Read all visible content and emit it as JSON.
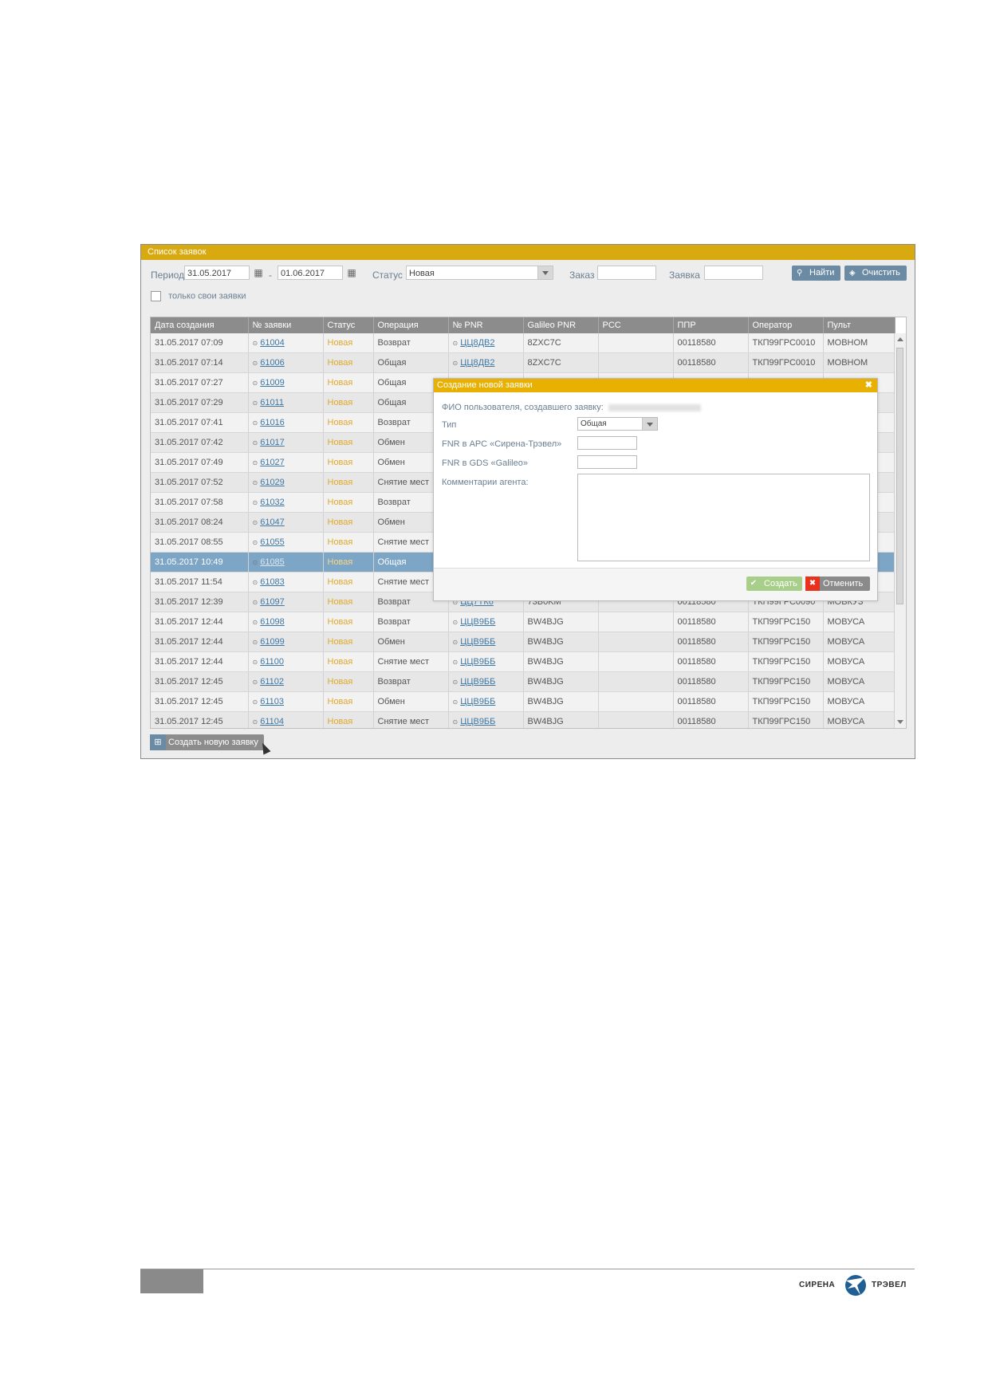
{
  "window": {
    "title": "Список заявок"
  },
  "filters": {
    "period_label": "Период",
    "date_from": "31.05.2017",
    "date_to": "01.06.2017",
    "dash": "-",
    "status_label": "Статус",
    "status_value": "Новая",
    "order_label": "Заказ",
    "order_value": "",
    "request_label": "Заявка",
    "request_value": "",
    "find_label": "Найти",
    "clear_label": "Очистить",
    "only_mine_label": "только свои заявки"
  },
  "table": {
    "columns": [
      "Дата создания",
      "№ заявки",
      "Статус",
      "Операция",
      "№ PNR",
      "Galileo PNR",
      "PCC",
      "ППР",
      "Оператор",
      "Пульт"
    ],
    "rows": [
      {
        "date": "31.05.2017 07:09",
        "num": "61004",
        "status": "Новая",
        "op": "Возврат",
        "pnr": "ЦЦ8ДВ2",
        "gpnr": "8ZXC7C",
        "pcc": "",
        "ppr": "00118580",
        "operator": "ТКП99ГРС0010",
        "pult": "МОВНОМ"
      },
      {
        "date": "31.05.2017 07:14",
        "num": "61006",
        "status": "Новая",
        "op": "Общая",
        "pnr": "ЦЦ8ДВ2",
        "gpnr": "8ZXC7C",
        "pcc": "",
        "ppr": "00118580",
        "operator": "ТКП99ГРС0010",
        "pult": "МОВНОМ"
      },
      {
        "date": "31.05.2017 07:27",
        "num": "61009",
        "status": "Новая",
        "op": "Общая",
        "pnr": "",
        "gpnr": "",
        "pcc": "",
        "ppr": "",
        "operator": "",
        "pult": ""
      },
      {
        "date": "31.05.2017 07:29",
        "num": "61011",
        "status": "Новая",
        "op": "Общая",
        "pnr": "",
        "gpnr": "",
        "pcc": "",
        "ppr": "",
        "operator": "",
        "pult": ""
      },
      {
        "date": "31.05.2017 07:41",
        "num": "61016",
        "status": "Новая",
        "op": "Возврат",
        "pnr": "",
        "gpnr": "",
        "pcc": "",
        "ppr": "",
        "operator": "",
        "pult": ""
      },
      {
        "date": "31.05.2017 07:42",
        "num": "61017",
        "status": "Новая",
        "op": "Обмен",
        "pnr": "",
        "gpnr": "",
        "pcc": "",
        "ppr": "",
        "operator": "",
        "pult": ""
      },
      {
        "date": "31.05.2017 07:49",
        "num": "61027",
        "status": "Новая",
        "op": "Обмен",
        "pnr": "",
        "gpnr": "",
        "pcc": "",
        "ppr": "",
        "operator": "",
        "pult": ""
      },
      {
        "date": "31.05.2017 07:52",
        "num": "61029",
        "status": "Новая",
        "op": "Снятие мест",
        "pnr": "",
        "gpnr": "",
        "pcc": "",
        "ppr": "",
        "operator": "",
        "pult": ""
      },
      {
        "date": "31.05.2017 07:58",
        "num": "61032",
        "status": "Новая",
        "op": "Возврат",
        "pnr": "",
        "gpnr": "",
        "pcc": "",
        "ppr": "",
        "operator": "",
        "pult": ""
      },
      {
        "date": "31.05.2017 08:24",
        "num": "61047",
        "status": "Новая",
        "op": "Обмен",
        "pnr": "",
        "gpnr": "",
        "pcc": "",
        "ppr": "",
        "operator": "",
        "pult": ""
      },
      {
        "date": "31.05.2017 08:55",
        "num": "61055",
        "status": "Новая",
        "op": "Снятие мест",
        "pnr": "",
        "gpnr": "",
        "pcc": "",
        "ppr": "",
        "operator": "",
        "pult": ""
      },
      {
        "date": "31.05.2017 10:49",
        "num": "61085",
        "status": "Новая",
        "op": "Общая",
        "pnr": "",
        "gpnr": "",
        "pcc": "",
        "ppr": "",
        "operator": "",
        "pult": ""
      },
      {
        "date": "31.05.2017 11:54",
        "num": "61083",
        "status": "Новая",
        "op": "Снятие мест",
        "pnr": "",
        "gpnr": "",
        "pcc": "",
        "ppr": "",
        "operator": "",
        "pult": ""
      },
      {
        "date": "31.05.2017 12:39",
        "num": "61097",
        "status": "Новая",
        "op": "Возврат",
        "pnr": "ЦЦ7ТК6",
        "gpnr": "73B0KM",
        "pcc": "",
        "ppr": "00118580",
        "operator": "ТКП99ГРС0090",
        "pult": "МОВКУЗ"
      },
      {
        "date": "31.05.2017 12:44",
        "num": "61098",
        "status": "Новая",
        "op": "Возврат",
        "pnr": "ЦЦВ9ББ",
        "gpnr": "BW4BJG",
        "pcc": "",
        "ppr": "00118580",
        "operator": "ТКП99ГРС150",
        "pult": "МОВУСА"
      },
      {
        "date": "31.05.2017 12:44",
        "num": "61099",
        "status": "Новая",
        "op": "Обмен",
        "pnr": "ЦЦВ9ББ",
        "gpnr": "BW4BJG",
        "pcc": "",
        "ppr": "00118580",
        "operator": "ТКП99ГРС150",
        "pult": "МОВУСА"
      },
      {
        "date": "31.05.2017 12:44",
        "num": "61100",
        "status": "Новая",
        "op": "Снятие мест",
        "pnr": "ЦЦВ9ББ",
        "gpnr": "BW4BJG",
        "pcc": "",
        "ppr": "00118580",
        "operator": "ТКП99ГРС150",
        "pult": "МОВУСА"
      },
      {
        "date": "31.05.2017 12:45",
        "num": "61102",
        "status": "Новая",
        "op": "Возврат",
        "pnr": "ЦЦВ9ББ",
        "gpnr": "BW4BJG",
        "pcc": "",
        "ppr": "00118580",
        "operator": "ТКП99ГРС150",
        "pult": "МОВУСА"
      },
      {
        "date": "31.05.2017 12:45",
        "num": "61103",
        "status": "Новая",
        "op": "Обмен",
        "pnr": "ЦЦВ9ББ",
        "gpnr": "BW4BJG",
        "pcc": "",
        "ppr": "00118580",
        "operator": "ТКП99ГРС150",
        "pult": "МОВУСА"
      },
      {
        "date": "31.05.2017 12:45",
        "num": "61104",
        "status": "Новая",
        "op": "Снятие мест",
        "pnr": "ЦЦВ9ББ",
        "gpnr": "BW4BJG",
        "pcc": "",
        "ppr": "00118580",
        "operator": "ТКП99ГРС150",
        "pult": "МОВУСА"
      }
    ]
  },
  "create_button": "Создать новую заявку",
  "dialog": {
    "title": "Создание новой заявки",
    "close": "✖",
    "user_label": "ФИО пользователя, создавшего заявку:",
    "type_label": "Тип",
    "type_value": "Общая",
    "pnr_arc_label": "FNR в АРС «Сирена-Трэвел»",
    "pnr_arc_value": "",
    "pnr_gds_label": "FNR в GDS «Galileo»",
    "pnr_gds_value": "",
    "comment_label": "Комментарии агента:",
    "comment_value": "",
    "create_label": "Создать",
    "cancel_label": "Отменить"
  },
  "footer": {
    "logo_left": "СИРЕНА",
    "logo_right": "ТРЭВЕЛ"
  },
  "colors": {
    "title_bar": "#d9a910",
    "dialog_title": "#e8b000",
    "selected_row": "#7da5c6",
    "status_new": "#e0a92c",
    "cancel_red": "#e8321e",
    "create_green": "#9ecc7a"
  }
}
